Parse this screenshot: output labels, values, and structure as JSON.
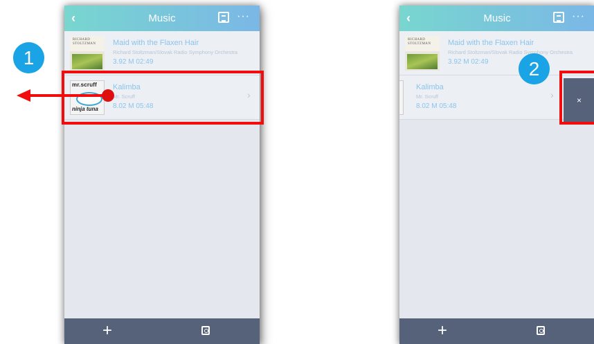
{
  "screens": [
    {
      "header": {
        "title": "Music",
        "back_icon": "chevron-left-icon",
        "manage_icon": "edit-list-icon",
        "more_label": "···"
      },
      "rows": [
        {
          "title": "Maid with the Flaxen Hair",
          "artist": "Richard Stoltzman/Slovak Radio Symphony Orchestra",
          "meta": "3.92 M 02:49",
          "art_text": "RICHARD STOLTZMAN"
        },
        {
          "title": "Kalimba",
          "artist": "Mr. Scruff",
          "meta": "8.02 M 05:48",
          "art_top": "mr.scruff",
          "art_bottom": "ninja tuna"
        }
      ],
      "footer": {
        "plus_label": "+",
        "share_icon": "share-icon"
      }
    },
    {
      "header": {
        "title": "Music",
        "back_icon": "chevron-left-icon",
        "manage_icon": "edit-list-icon",
        "more_label": "···"
      },
      "rows": [
        {
          "title": "Maid with the Flaxen Hair",
          "artist": "Richard Stoltzman/Slovak Radio Symphony Orchestra",
          "meta": "3.92 M 02:49",
          "art_text": "RICHARD STOLTZMAN"
        },
        {
          "title": "Kalimba",
          "artist": "Mr. Scruff",
          "meta": "8.02 M 05:48"
        }
      ],
      "delete_label": "×",
      "footer": {
        "plus_label": "+",
        "share_icon": "share-icon"
      }
    }
  ],
  "annotations": {
    "step1": "1",
    "step2": "2",
    "highlight_color": "#f10d0d",
    "badge_color": "#1aa4e5"
  },
  "colors": {
    "header_start": "#78d6cf",
    "header_end": "#7ab7e6",
    "footer": "#56617a",
    "background": "#e4e7ed",
    "title_text": "#8cc4ee"
  }
}
